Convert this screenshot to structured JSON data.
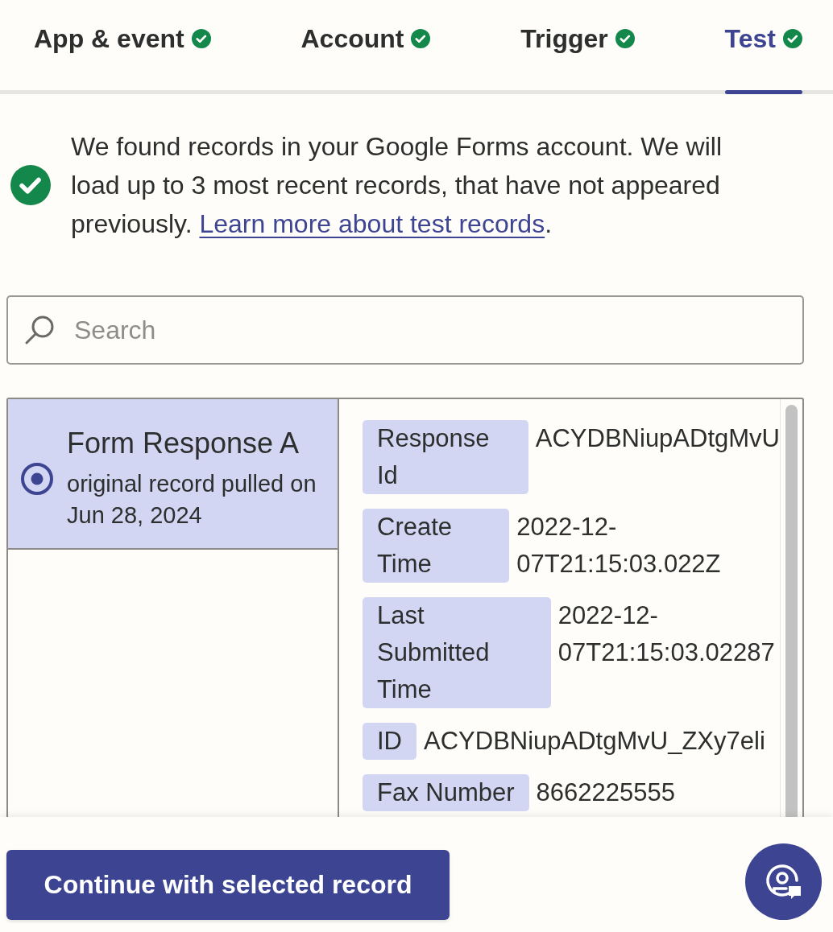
{
  "tabs": [
    {
      "label": "App & event",
      "complete": true,
      "selected": false
    },
    {
      "label": "Account",
      "complete": true,
      "selected": false
    },
    {
      "label": "Trigger",
      "complete": true,
      "selected": false
    },
    {
      "label": "Test",
      "complete": true,
      "selected": true
    }
  ],
  "notice": {
    "kind": "success",
    "text": "We found records in your Google Forms account. We will load up to 3 most recent records, that have not appeared previously.",
    "link": "Learn more about test records",
    "after_link": "."
  },
  "search": {
    "placeholder": "Search"
  },
  "records": [
    {
      "title": "Form Response A",
      "subtitle": "original record pulled on Jun 28, 2024",
      "selected": true
    }
  ],
  "fields": [
    {
      "label": "Response Id",
      "value": "ACYDBNiupADtgMvU"
    },
    {
      "label": "Create Time",
      "value": "2022-12-07T21:15:03.022Z"
    },
    {
      "label": "Last Submitted Time",
      "value": "2022-12-07T21:15:03.02287"
    },
    {
      "label": "ID",
      "value": "ACYDBNiupADtgMvU_ZXy7eli"
    },
    {
      "label": "Fax Number",
      "value": "8662225555"
    }
  ],
  "footer": {
    "button": "Continue with selected record"
  }
}
